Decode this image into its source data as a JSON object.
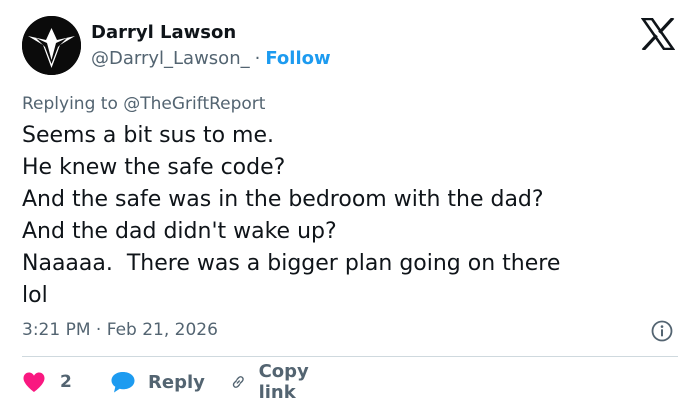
{
  "author": {
    "name": "Darryl Lawson",
    "handle": "@Darryl_Lawson_",
    "separator": "·",
    "follow_label": "Follow"
  },
  "reply_context": {
    "prefix": "Replying to",
    "mention": "@TheGriftReport"
  },
  "tweet": {
    "lines": [
      "Seems a bit sus to me.",
      "He knew the safe code?",
      "And the safe was in the bedroom with the dad?",
      "And the dad didn't wake up?",
      "Naaaaa.  There was a bigger plan going on there",
      "lol"
    ],
    "time": "3:21 PM",
    "separator": "·",
    "date": "Feb 21, 2026"
  },
  "actions": {
    "like_count": "2",
    "reply_label": "Reply",
    "copy_link_label": "Copy link"
  },
  "icons": {
    "brand": "x-logo-icon",
    "like": "heart-icon",
    "reply": "speech-bubble-icon",
    "copy": "link-icon",
    "info": "info-icon"
  },
  "colors": {
    "text": "#0f1419",
    "secondary": "#536471",
    "accent": "#1d9bf0",
    "like": "#f91880",
    "divider": "#cfd9de"
  }
}
